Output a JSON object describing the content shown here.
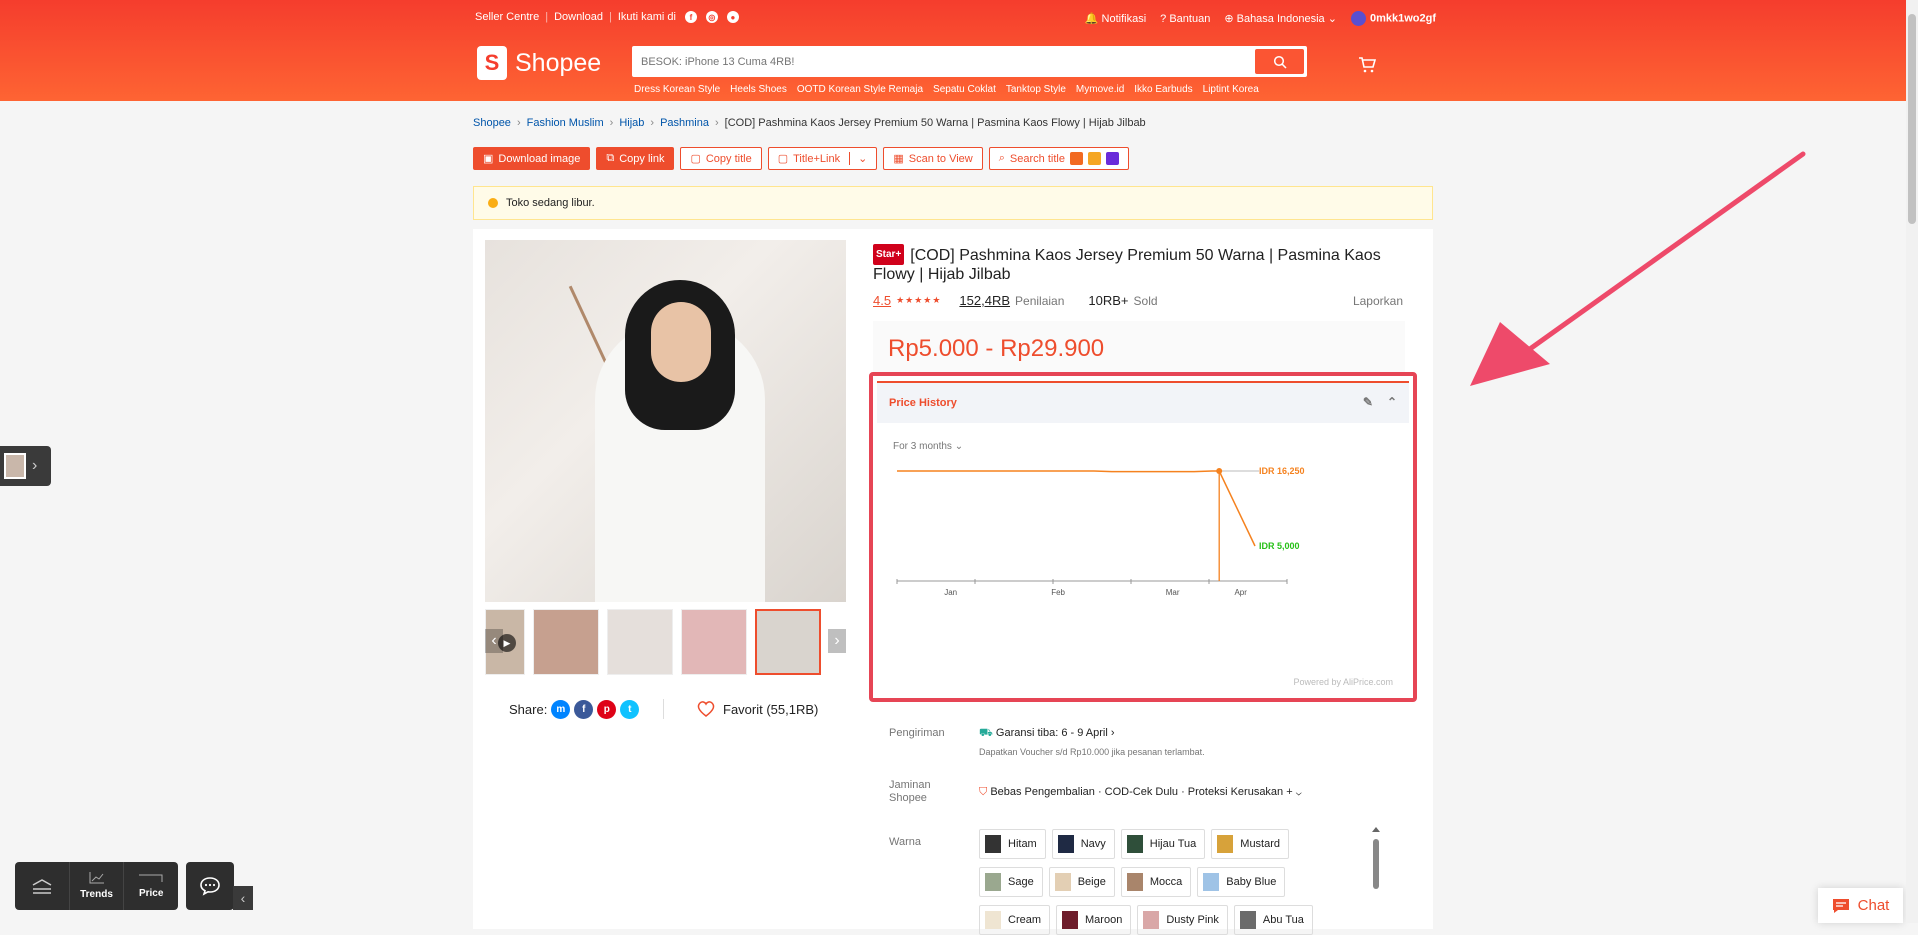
{
  "header": {
    "seller_centre": "Seller Centre",
    "download": "Download",
    "follow": "Ikuti kami di",
    "notifications": "Notifikasi",
    "help": "Bantuan",
    "language": "Bahasa Indonesia",
    "username": "0mkk1wo2gf",
    "logo_text": "Shopee",
    "search_placeholder": "BESOK: iPhone 13 Cuma 4RB!",
    "quick_links": [
      "Dress Korean Style",
      "Heels Shoes",
      "OOTD Korean Style Remaja",
      "Sepatu Coklat",
      "Tanktop Style",
      "Mymove.id",
      "Ikko Earbuds",
      "Liptint Korea"
    ]
  },
  "breadcrumb": [
    "Shopee",
    "Fashion Muslim",
    "Hijab",
    "Pashmina",
    "[COD] Pashmina Kaos Jersey Premium 50 Warna | Pasmina Kaos Flowy | Hijab Jilbab"
  ],
  "toolbar": {
    "download_image": "Download image",
    "copy_link": "Copy link",
    "copy_title": "Copy title",
    "title_link": "Title+Link",
    "scan_to_view": "Scan to View",
    "search_title": "Search title"
  },
  "notice": "Toko sedang libur.",
  "product": {
    "badge": "Star+",
    "title": "[COD] Pashmina Kaos Jersey Premium 50 Warna | Pasmina Kaos Flowy | Hijab Jilbab",
    "rating": "4.5",
    "reviews": "152,4RB",
    "reviews_label": "Penilaian",
    "sold": "10RB+",
    "sold_label": "Sold",
    "report": "Laporkan",
    "price": "Rp5.000 - Rp29.900",
    "share_label": "Share:",
    "favorite": "Favorit (55,1RB)"
  },
  "price_history": {
    "title": "Price History",
    "range": "For 3 months",
    "powered_by": "Powered by AliPrice.com"
  },
  "chart_data": {
    "type": "line",
    "x_ticks": [
      "Jan",
      "Feb",
      "Mar",
      "Apr"
    ],
    "series": [
      {
        "points": [
          [
            0.0,
            16250
          ],
          [
            0.55,
            16250
          ],
          [
            0.6,
            16150
          ],
          [
            0.83,
            16150
          ],
          [
            0.88,
            16250
          ],
          [
            0.9,
            16250
          ],
          [
            1.0,
            5000
          ]
        ]
      }
    ],
    "annotations": [
      "IDR 16,250",
      "IDR 5,000"
    ],
    "colors": {
      "line": "#f5821f",
      "high": "#f5821f",
      "low": "#26c017"
    }
  },
  "details": {
    "shipping_label": "Pengiriman",
    "shipping_value": "Garansi tiba: 6 - 9 April",
    "shipping_note": "Dapatkan Voucher s/d Rp10.000 jika pesanan terlambat.",
    "guarantee_label": "Jaminan Shopee",
    "guarantee_value": "Bebas Pengembalian · COD-Cek Dulu · Proteksi Kerusakan +",
    "color_label": "Warna",
    "variants": [
      "Hitam",
      "Navy",
      "Hijau Tua",
      "Mustard",
      "Sage",
      "Beige",
      "Mocca",
      "Baby Blue",
      "Cream",
      "Maroon",
      "Dusty Pink",
      "Abu Tua"
    ]
  },
  "dock": {
    "trends": "Trends",
    "price": "Price"
  },
  "chat": "Chat",
  "colors": {
    "brand": "#ee4d2d",
    "highlight": "#e64555"
  }
}
